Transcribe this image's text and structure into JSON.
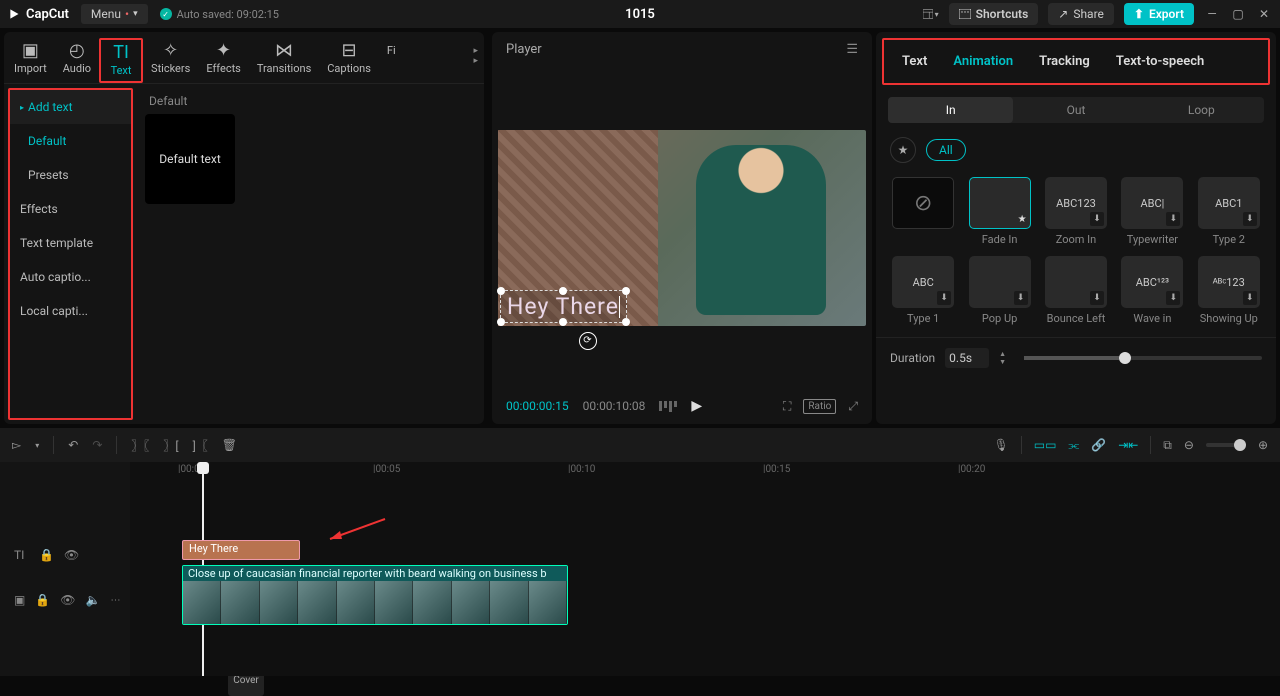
{
  "app_name": "CapCut",
  "menu_label": "Menu",
  "autosave": "Auto saved: 09:02:15",
  "project_title": "1015",
  "topbar": {
    "shortcuts": "Shortcuts",
    "share": "Share",
    "export": "Export"
  },
  "tools": {
    "import": "Import",
    "audio": "Audio",
    "text": "Text",
    "stickers": "Stickers",
    "effects": "Effects",
    "transitions": "Transitions",
    "captions": "Captions",
    "filters": "Fi"
  },
  "text_sidebar": {
    "add_text": "Add text",
    "default": "Default",
    "presets": "Presets",
    "effects": "Effects",
    "text_template": "Text template",
    "auto_captions": "Auto captio...",
    "local_captions": "Local capti..."
  },
  "thumb": {
    "section": "Default",
    "label": "Default text"
  },
  "player": {
    "title": "Player",
    "overlay_text": "Hey There",
    "tc_current": "00:00:00:15",
    "tc_total": "00:00:10:08",
    "ratio": "Ratio"
  },
  "right": {
    "tabs": {
      "text": "Text",
      "animation": "Animation",
      "tracking": "Tracking",
      "tts": "Text-to-speech"
    },
    "segments": {
      "in": "In",
      "out": "Out",
      "loop": "Loop"
    },
    "filter_all": "All",
    "anims": [
      {
        "name": "",
        "preview": "⊘",
        "none": true
      },
      {
        "name": "Fade In",
        "preview": "",
        "selected": true,
        "star": true
      },
      {
        "name": "Zoom In",
        "preview": "ABC123",
        "dl": true
      },
      {
        "name": "Typewriter",
        "preview": "ABC|",
        "dl": true
      },
      {
        "name": "Type 2",
        "preview": "ABC1",
        "dl": true
      },
      {
        "name": "Type 1",
        "preview": "ABC",
        "dl": true
      },
      {
        "name": "Pop Up",
        "preview": "",
        "dl": true
      },
      {
        "name": "Bounce Left",
        "preview": "",
        "dl": true
      },
      {
        "name": "Wave in",
        "preview": "ABC¹²³",
        "dl": true
      },
      {
        "name": "Showing Up",
        "preview": "ᴬᴮᶜ123",
        "dl": true
      }
    ],
    "duration_label": "Duration",
    "duration_value": "0.5s"
  },
  "timeline": {
    "ruler": [
      "|00:00",
      "|00:05",
      "|00:10",
      "|00:15",
      "|00:20"
    ],
    "text_clip": "Hey There",
    "video_clip": "Close up of caucasian financial reporter with beard walking on business b",
    "cover": "Cover"
  }
}
